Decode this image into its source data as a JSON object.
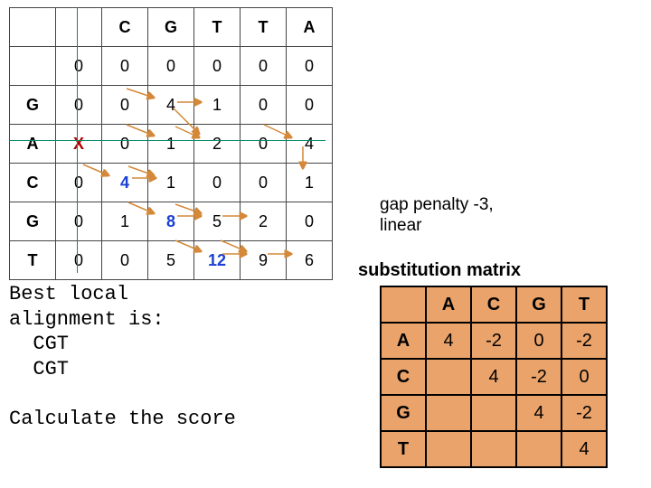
{
  "dp": {
    "col_headers": [
      "",
      "",
      "C",
      "G",
      "T",
      "T",
      "A"
    ],
    "row_headers": [
      "",
      "",
      "G",
      "A",
      "C",
      "G",
      "T"
    ],
    "x_mark": "X",
    "cells": [
      [
        "",
        "",
        "C",
        "G",
        "T",
        "T",
        "A"
      ],
      [
        "",
        "0",
        "0",
        "0",
        "0",
        "0",
        "0"
      ],
      [
        "G",
        "0",
        "0",
        "4",
        "1",
        "0",
        "0"
      ],
      [
        "A",
        "X",
        "0",
        "1",
        "2",
        "0",
        "4"
      ],
      [
        "C",
        "0",
        "4",
        "1",
        "0",
        "0",
        "1"
      ],
      [
        "G",
        "0",
        "1",
        "8",
        "5",
        "2",
        "0"
      ],
      [
        "T",
        "0",
        "0",
        "5",
        "12",
        "9",
        "6"
      ]
    ],
    "highlight": [
      [
        4,
        2
      ],
      [
        5,
        3
      ],
      [
        6,
        4
      ]
    ]
  },
  "best": {
    "line1": "Best local",
    "line2": "alignment is:",
    "line3": "  CGT",
    "line4": "  CGT",
    "line5": "Calculate the score"
  },
  "gap": {
    "line1": "gap penalty -3,",
    "line2": "linear"
  },
  "sub": {
    "title": "substitution matrix",
    "cols": [
      "A",
      "C",
      "G",
      "T"
    ],
    "rows": [
      "A",
      "C",
      "G",
      "T"
    ],
    "values": [
      [
        "4",
        "-2",
        "0",
        "-2"
      ],
      [
        "",
        "4",
        "-2",
        "0"
      ],
      [
        "",
        "",
        "4",
        "-2"
      ],
      [
        "",
        "",
        "",
        "4"
      ]
    ]
  }
}
